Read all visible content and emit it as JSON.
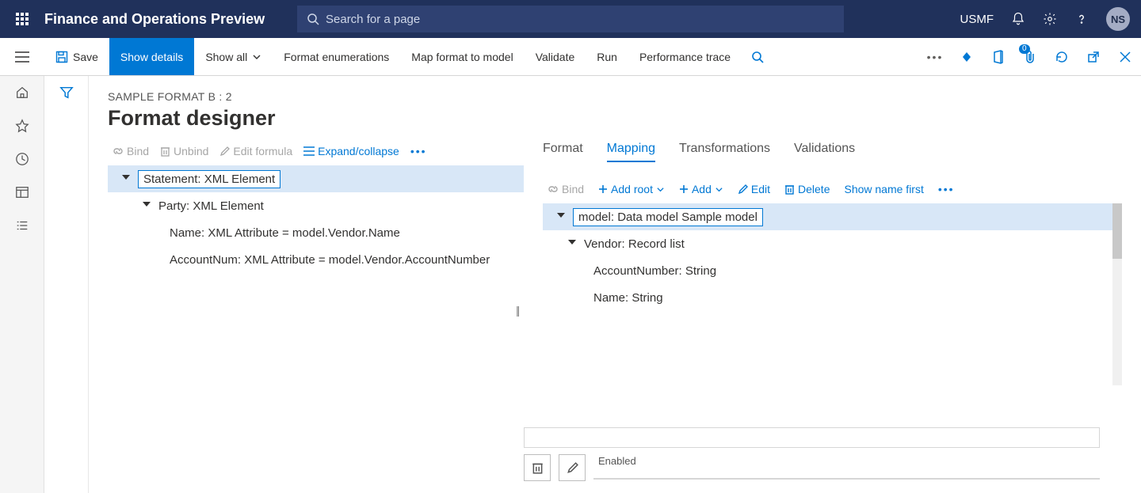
{
  "header": {
    "app_title": "Finance and Operations Preview",
    "search_placeholder": "Search for a page",
    "company": "USMF",
    "avatar_initials": "NS"
  },
  "actionpane": {
    "save": "Save",
    "show_details": "Show details",
    "show_all": "Show all",
    "format_enum": "Format enumerations",
    "map_format": "Map format to model",
    "validate": "Validate",
    "run": "Run",
    "perf_trace": "Performance trace",
    "attach_badge": "0"
  },
  "page": {
    "caption": "SAMPLE FORMAT B : 2",
    "title": "Format designer"
  },
  "left_toolbar": {
    "bind": "Bind",
    "unbind": "Unbind",
    "edit_formula": "Edit formula",
    "expand": "Expand/collapse"
  },
  "format_tree": {
    "n0": "Statement: XML Element",
    "n1": "Party: XML Element",
    "n2": "Name: XML Attribute = model.Vendor.Name",
    "n3": "AccountNum: XML Attribute = model.Vendor.AccountNumber"
  },
  "tabs": {
    "format": "Format",
    "mapping": "Mapping",
    "transformations": "Transformations",
    "validations": "Validations"
  },
  "right_toolbar": {
    "bind": "Bind",
    "add_root": "Add root",
    "add": "Add",
    "edit": "Edit",
    "delete": "Delete",
    "show_name_first": "Show name first"
  },
  "mapping_tree": {
    "n0": "model: Data model Sample model",
    "n1": "Vendor: Record list",
    "n2": "AccountNumber: String",
    "n3": "Name: String"
  },
  "bottom": {
    "enabled": "Enabled"
  }
}
